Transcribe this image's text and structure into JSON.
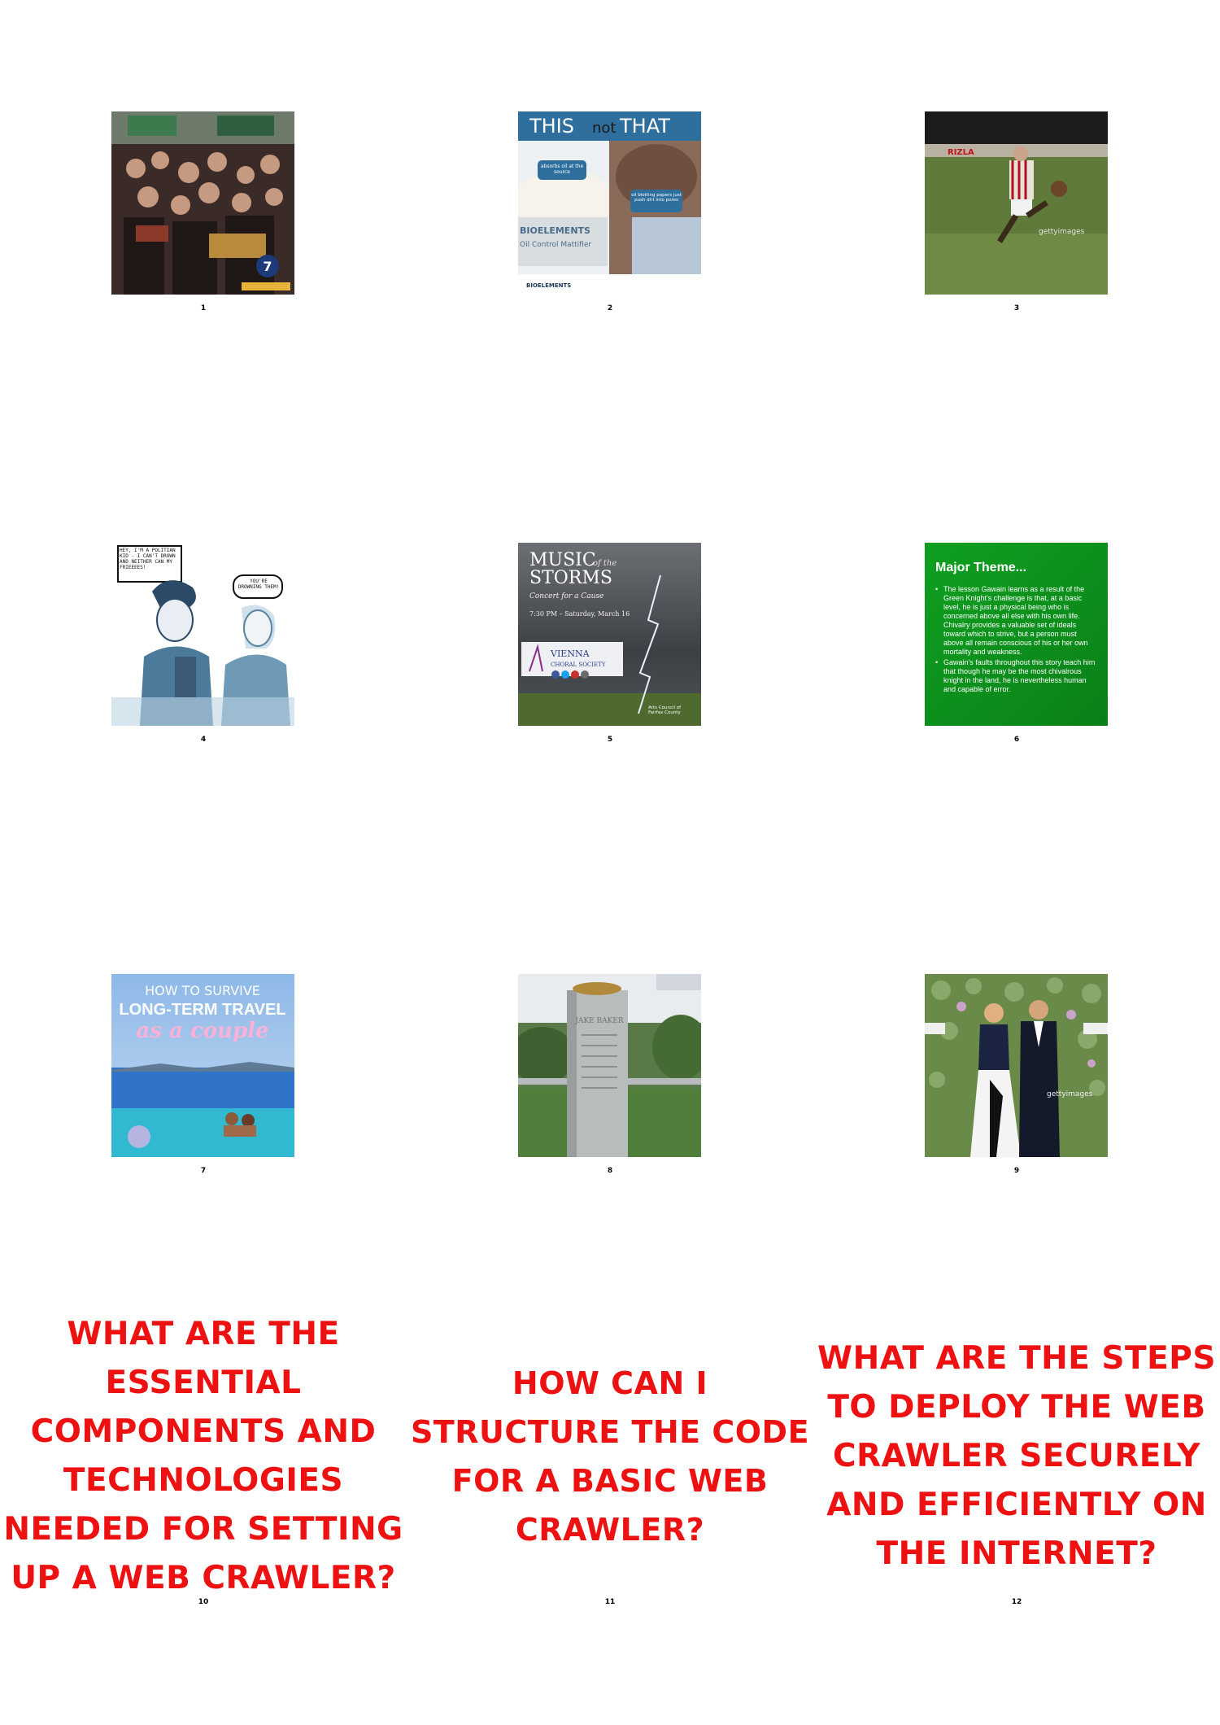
{
  "pages": [
    {
      "number": "1"
    },
    {
      "number": "2",
      "title_left": "THIS",
      "title_mid": "not",
      "title_right": "THAT",
      "callout1": "absorbs oil at the source",
      "callout2": "oil blotting papers just push dirt into pores",
      "jar_brand": "BIOELEMENTS",
      "jar_product": "Oil Control Mattifier",
      "footer_brand": "BIOELEMENTS"
    },
    {
      "number": "3",
      "stand_sign": "RIZLA",
      "watermark": "gettyimages"
    },
    {
      "number": "4",
      "bubble1": "HEY, I'M A POLITIAN KID - I CAN'T DROWN AND NEITHER CAN MY FRIEEEES!",
      "bubble2": "YOU'RE DROWNING THEM!"
    },
    {
      "number": "5",
      "title1": "MUSIC",
      "title_small": "of the",
      "title2": "STORMS",
      "subtitle": "Concert for a Cause",
      "date": "7:30 PM – Saturday, March 16",
      "org1": "VIENNA",
      "org2": "CHORAL SOCIETY",
      "sponsor": "Arts Council of Fairfax County"
    },
    {
      "number": "6",
      "heading": "Major Theme...",
      "bullets": [
        "The lesson Gawain learns as a result of the Green Knight's challenge is that, at a basic level, he is just a physical being who is concerned above all else with his own life. Chivalry provides a valuable set of ideals toward which to strive, but a person must above all remain conscious of his or her own mortality and weakness.",
        "Gawain's faults throughout this story teach him that though he may be the most chivalrous knight in the land, he is nevertheless human and capable of error."
      ]
    },
    {
      "number": "7",
      "line1": "HOW TO SURVIVE",
      "line2": "LONG-TERM TRAVEL",
      "line3": "as a couple"
    },
    {
      "number": "8",
      "inscription": "JAKE BAKER"
    },
    {
      "number": "9",
      "watermark": "gettyimages"
    },
    {
      "number": "10",
      "question": "What are the essential components and technologies needed for setting up a web crawler?"
    },
    {
      "number": "11",
      "question": "How can I structure the code for a basic web crawler?"
    },
    {
      "number": "12",
      "question": "What are the steps to deploy the web crawler securely and efficiently on the internet?"
    }
  ],
  "colors": {
    "question_text": "#ee1111",
    "slide_green": "#0a8f1a",
    "bioelements_blue": "#2e6f9e"
  },
  "icons": [
    "abc7-logo-icon",
    "news-ticker-icon"
  ]
}
